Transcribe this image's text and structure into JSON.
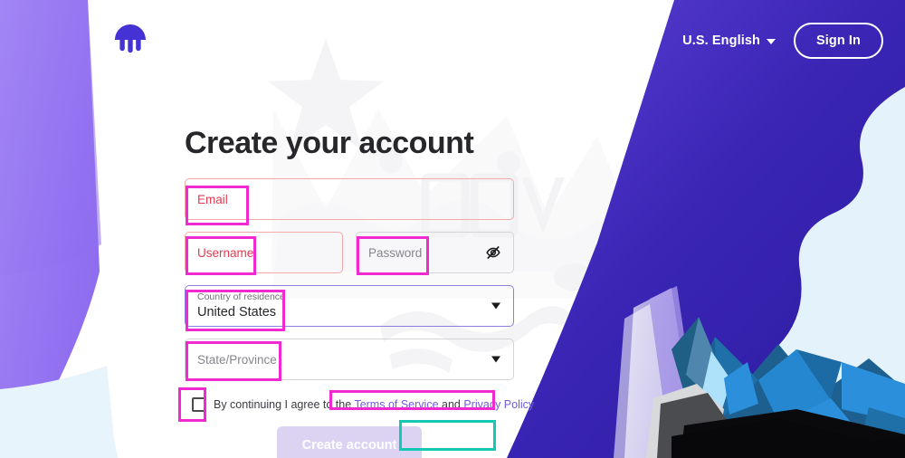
{
  "header": {
    "logo_name": "kraken-logo",
    "language": {
      "label": "U.S. English",
      "caret": "chevron-down-icon"
    },
    "sign_in_label": "Sign In"
  },
  "main": {
    "title": "Create your account",
    "fields": {
      "email": {
        "label": "Email",
        "value": "",
        "placeholder": "Email",
        "state": "error"
      },
      "username": {
        "label": "Username",
        "value": "",
        "placeholder": "Username",
        "state": "error"
      },
      "password": {
        "label": "Password",
        "value": "",
        "placeholder": "Password",
        "state": "default",
        "toggle_icon": "eye-slash-icon"
      },
      "country": {
        "label": "Country of residence",
        "value": "United States",
        "state": "focused",
        "caret": "chevron-down-icon"
      },
      "state": {
        "label": "State/Province",
        "value": "",
        "placeholder": "State/Province",
        "state": "default",
        "caret": "chevron-down-icon"
      }
    },
    "terms": {
      "checkbox_checked": false,
      "prefix": "By continuing I agree to the ",
      "terms_link": "Terms of Service",
      "conjunction": " and ",
      "privacy_link": "Privacy Policy",
      "suffix": "."
    },
    "submit_label": "Create account"
  },
  "annotations": {
    "color_magenta": "#f029d0",
    "color_teal": "#14c8b4",
    "boxes": [
      {
        "name": "email-label",
        "color": "magenta"
      },
      {
        "name": "username-label",
        "color": "magenta"
      },
      {
        "name": "password-label",
        "color": "magenta"
      },
      {
        "name": "country-label",
        "color": "magenta"
      },
      {
        "name": "state-label",
        "color": "magenta"
      },
      {
        "name": "terms-checkbox",
        "color": "magenta"
      },
      {
        "name": "terms-links",
        "color": "magenta"
      },
      {
        "name": "create-account-button",
        "color": "teal"
      }
    ]
  },
  "theme": {
    "brand_purple": "#5741d9",
    "header_purple": "#2d1f9e",
    "left_panel_purple": "#9a7bf0",
    "ice_blue": "#e7f4fb",
    "error_red": "#e8384f",
    "link_purple": "#6f5ce0",
    "button_disabled": "#dcd3f3"
  }
}
